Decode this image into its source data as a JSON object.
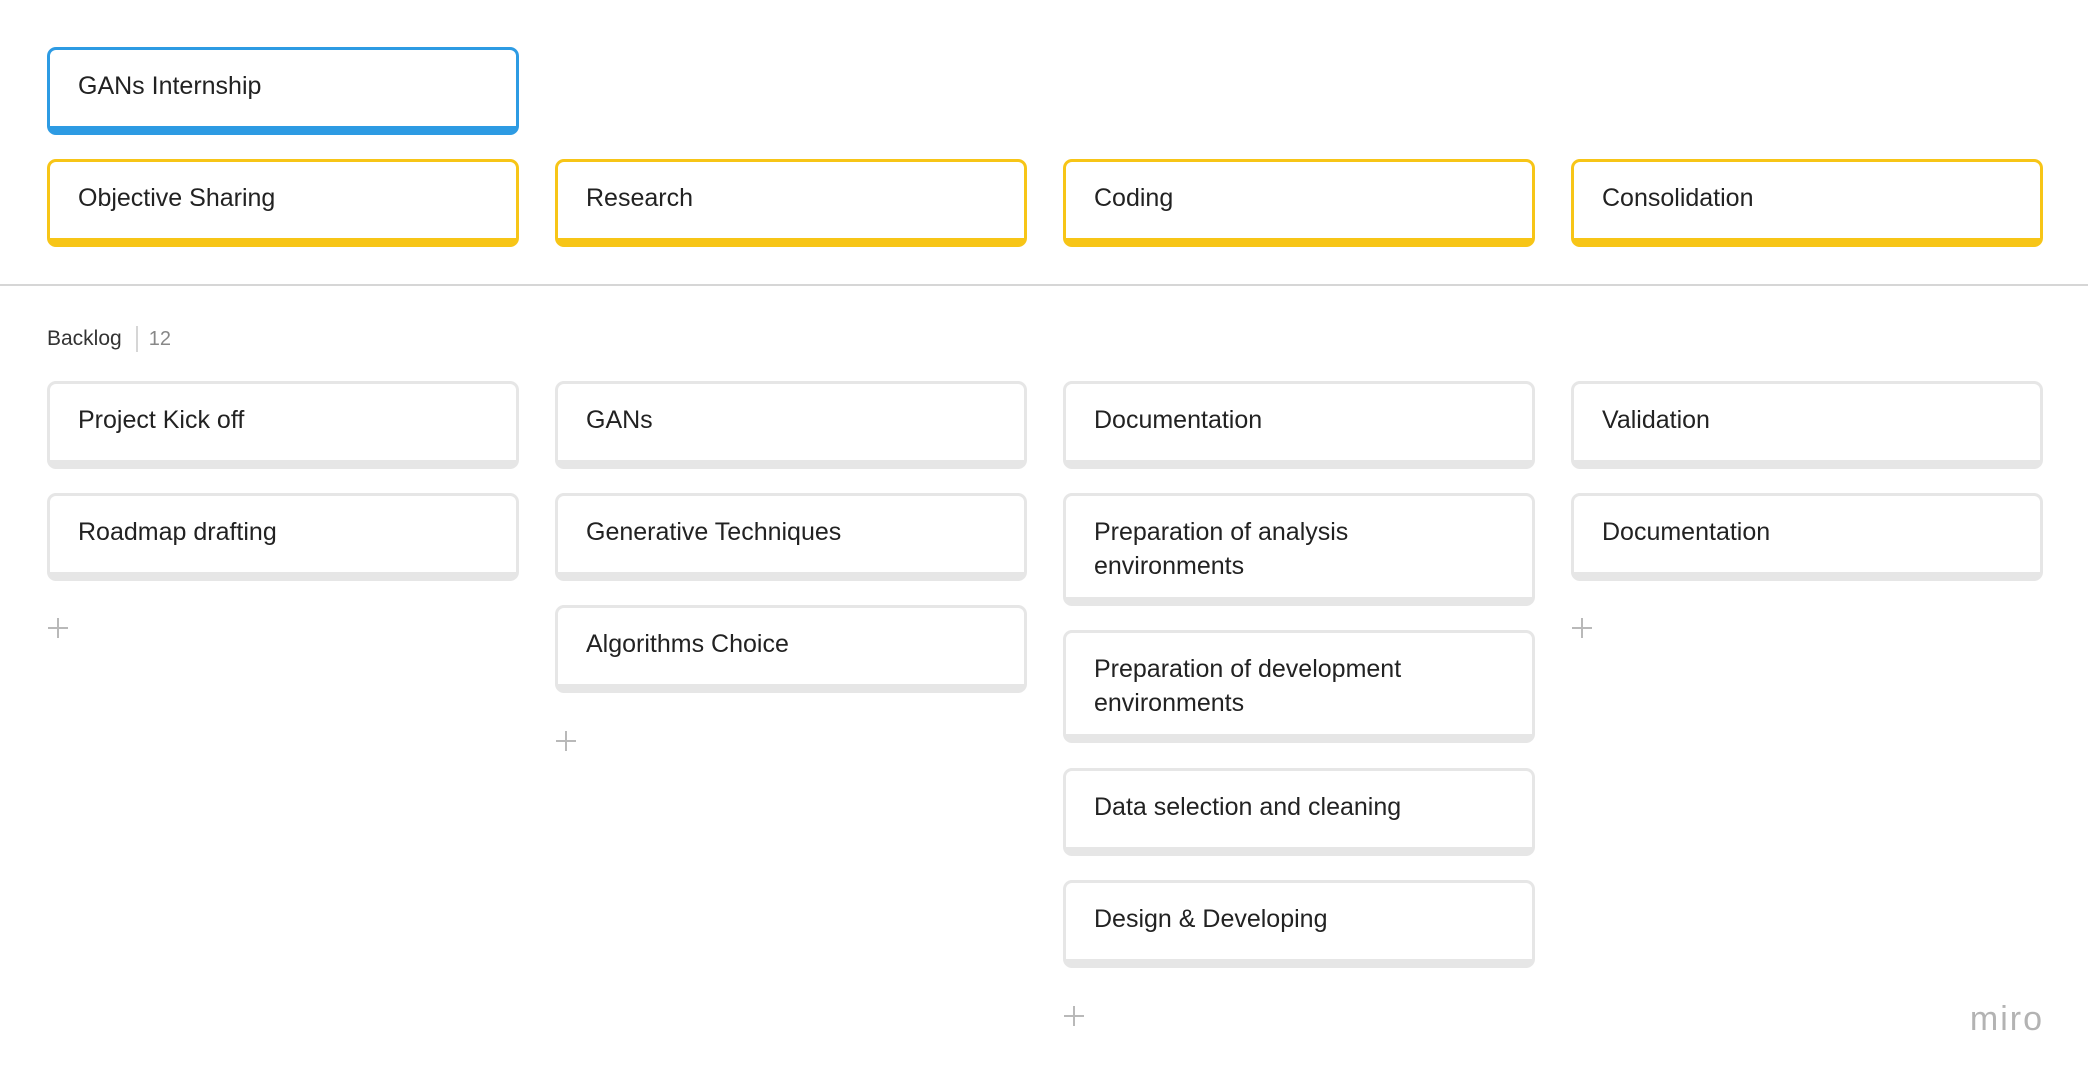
{
  "board_title": "GANs Internship",
  "stages": [
    "Objective Sharing",
    "Research",
    "Coding",
    "Consolidation"
  ],
  "backlog": {
    "label": "Backlog",
    "count": "12"
  },
  "columns": [
    {
      "cards": [
        "Project Kick off",
        "Roadmap drafting"
      ]
    },
    {
      "cards": [
        "GANs",
        "Generative Techniques",
        "Algorithms Choice"
      ]
    },
    {
      "cards": [
        "Documentation",
        "Preparation of analysis environments",
        "Preparation of development environments",
        "Data selection and cleaning",
        "Design & Developing"
      ]
    },
    {
      "cards": [
        "Validation",
        "Documentation"
      ]
    }
  ],
  "logo": "miro",
  "colors": {
    "title_border": "#2d9be3",
    "stage_border": "#f7c517",
    "card_border": "#e6e6e6"
  }
}
